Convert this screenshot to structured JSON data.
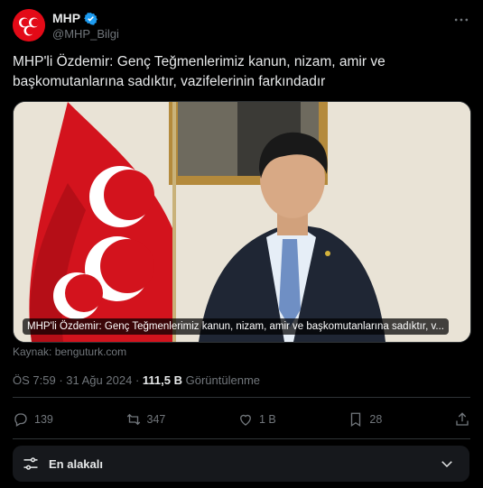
{
  "author": {
    "name": "MHP",
    "handle": "@MHP_Bilgi",
    "verified": true,
    "avatar_color": "#e30a17"
  },
  "tweet": {
    "text": "MHP'li Özdemir: Genç Teğmenlerimiz kanun, nizam, amir ve başkomutanlarına sadıktır, vazifelerinin farkındadır"
  },
  "media": {
    "caption": "MHP'li Özdemir: Genç Teğmenlerimiz kanun, nizam, amir ve başkomutanlarına sadıktır, v...",
    "source": "Kaynak: benguturk.com"
  },
  "meta": {
    "time": "ÖS 7:59",
    "date": "31 Ağu 2024",
    "views_count": "111,5 B",
    "views_label": "Görüntülenme"
  },
  "actions": {
    "replies": "139",
    "reposts": "347",
    "likes": "1 B",
    "bookmarks": "28"
  },
  "sort": {
    "label": "En alakalı"
  },
  "colors": {
    "background": "#000000",
    "text": "#e7e9ea",
    "muted": "#71767b",
    "verified": "#1d9bf0",
    "divider": "#2f3336"
  }
}
